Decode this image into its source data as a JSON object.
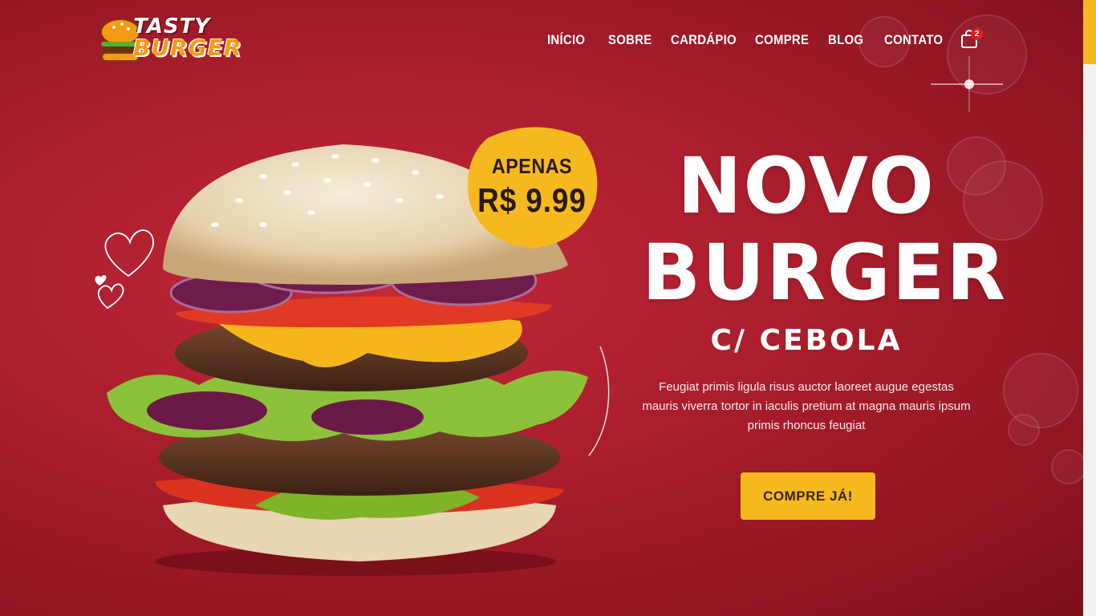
{
  "brand": {
    "logo_line1": "TASTY",
    "logo_line2": "BURGER"
  },
  "nav": {
    "items": [
      {
        "label": "INÍCIO"
      },
      {
        "label": "SOBRE"
      },
      {
        "label": "CARDÁPIO"
      },
      {
        "label": "COMPRE"
      },
      {
        "label": "BLOG"
      },
      {
        "label": "CONTATO"
      }
    ],
    "cart": {
      "icon": "shopping-bag-icon",
      "count": "2"
    }
  },
  "promo": {
    "label": "APENAS",
    "price": "R$ 9.99"
  },
  "hero": {
    "title_line1": "NOVO",
    "title_line2": "BURGER",
    "subtitle": "C/ CEBOLA",
    "description": "Feugiat primis ligula risus auctor laoreet augue egestas mauris viverra tortor in iaculis pretium at magna mauris ipsum primis rhoncus feugiat",
    "cta_label": "COMPRE JÁ!"
  },
  "colors": {
    "background": "#a81d2c",
    "accent": "#f5b91f",
    "badge": "#e41d1d"
  }
}
